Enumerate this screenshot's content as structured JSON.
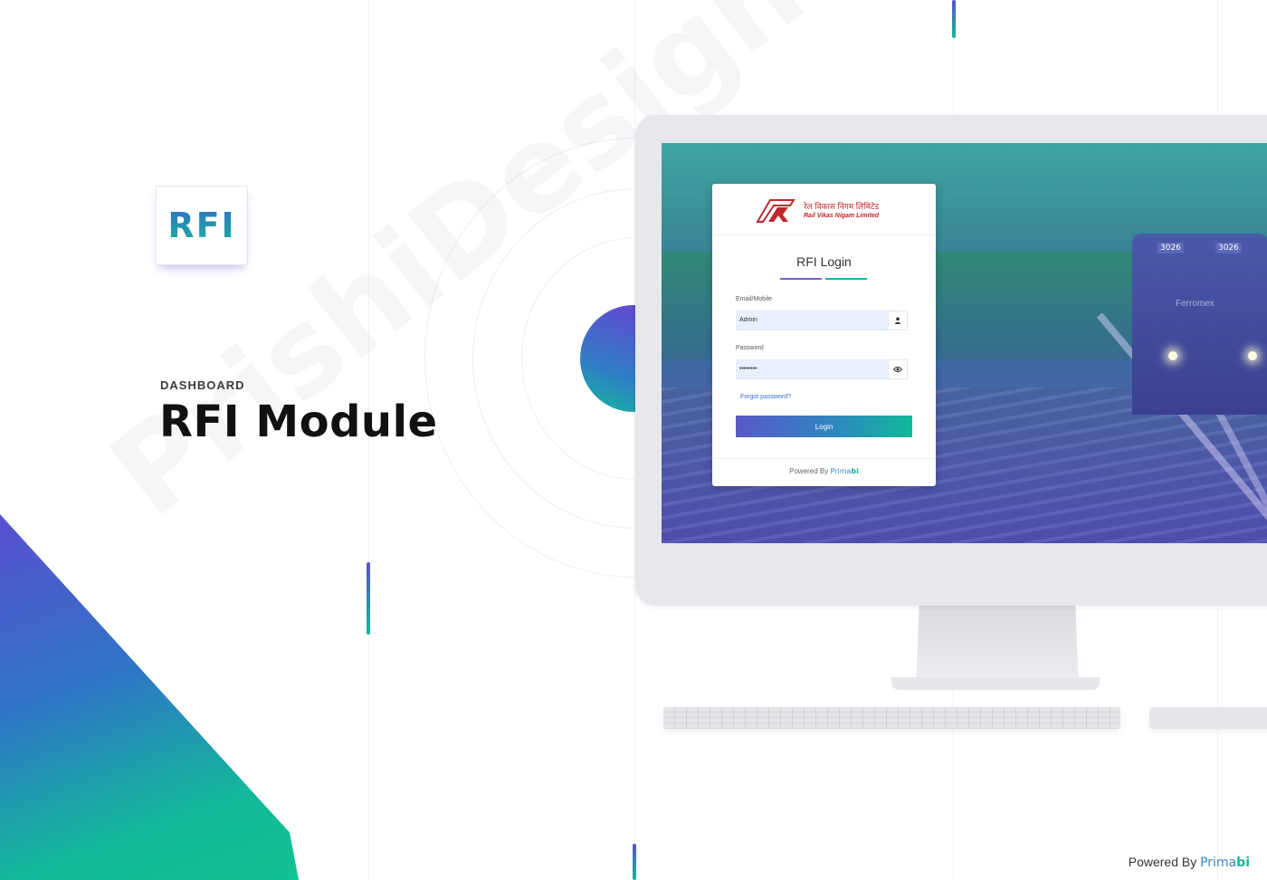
{
  "branding": {
    "logo_text": "RFI",
    "accent_colors": [
      "#5b4fcf",
      "#14b99a"
    ]
  },
  "hero": {
    "eyebrow": "DASHBOARD",
    "title": "RFI Module",
    "watermark": "PrishiDesigner"
  },
  "login_screen": {
    "org_name_hindi": "रेल विकास निगम लिमिटेड",
    "org_name_en": "Rail Vikas Nigam Limited",
    "title": "RFI Login",
    "email_label": "Email/Mobile",
    "email_value": "Admin",
    "email_icon": "user-icon",
    "password_label": "Password",
    "password_value": "••••••••",
    "password_icon": "eye-icon",
    "forgot_link": "Forgot password?",
    "login_button": "Login",
    "footer_prefix": "Powered By",
    "footer_brand_a": "Prima",
    "footer_brand_b": "bi",
    "loco_number_left": "3026",
    "loco_number_right": "3026",
    "loco_brand": "Ferromex"
  },
  "footer": {
    "prefix": "Powered By",
    "brand_a": "Prima",
    "brand_b": "bi"
  }
}
